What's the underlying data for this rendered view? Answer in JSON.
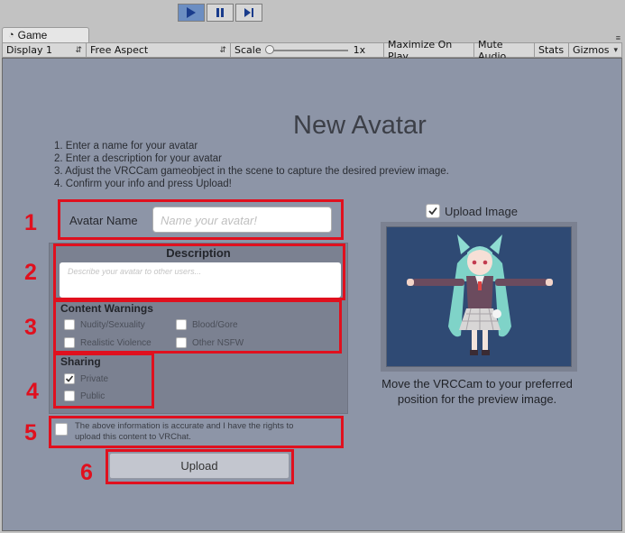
{
  "playbar": {
    "play": "play",
    "pause": "pause",
    "step": "step"
  },
  "tab": {
    "label": "Game",
    "menu": "≡"
  },
  "toolbar": {
    "display": "Display 1",
    "aspect": "Free Aspect",
    "scale_label": "Scale",
    "scale_value": "1x",
    "scale_level": 0.0,
    "maximize": "Maximize On Play",
    "mute": "Mute Audio",
    "stats": "Stats",
    "gizmos": "Gizmos"
  },
  "panel": {
    "title": "New Avatar",
    "instructions": [
      "1. Enter a name for your avatar",
      "2. Enter a description for your avatar",
      "3. Adjust the VRCCam gameobject in the scene to capture the desired preview image.",
      "4. Confirm your info and press Upload!"
    ],
    "name_label": "Avatar Name",
    "name_placeholder": "Name your avatar!",
    "description_label": "Description",
    "description_placeholder": "Describe your avatar to other users...",
    "content_warnings_label": "Content Warnings",
    "warnings": [
      {
        "label": "Nudity/Sexuality",
        "checked": false
      },
      {
        "label": "Blood/Gore",
        "checked": false
      },
      {
        "label": "Realistic Violence",
        "checked": false
      },
      {
        "label": "Other NSFW",
        "checked": false
      }
    ],
    "sharing_label": "Sharing",
    "sharing": [
      {
        "label": "Private",
        "checked": true
      },
      {
        "label": "Public",
        "checked": false
      }
    ],
    "rights_text_1": "The above information is accurate and I have the rights to",
    "rights_text_2": "upload this content to VRChat.",
    "upload_button": "Upload",
    "upload_image_label": "Upload Image",
    "upload_image_checked": true,
    "caption_1": "Move the VRCCam to your preferred",
    "caption_2": "position for the preview image."
  },
  "annotations": [
    "1",
    "2",
    "3",
    "4",
    "5",
    "6"
  ],
  "colors": {
    "annotation": "#e0101e",
    "panel_bg": "#8d95a7",
    "preview_bg": "#2f4a74",
    "play_active": "#6c8ec2"
  }
}
